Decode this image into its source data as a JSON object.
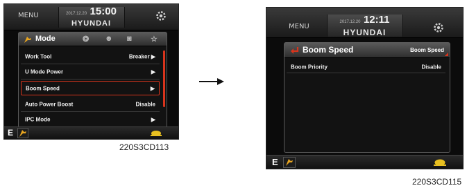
{
  "left": {
    "header": {
      "menu": "MENU",
      "date": "2017.12.20",
      "time": "15:00",
      "brand": "HYUNDAI",
      "settings_icon": "settings-gear-icon"
    },
    "panel": {
      "title": "Mode",
      "tabs": [
        "mode-tab-icon",
        "settings-tab-icon",
        "user-tab-icon",
        "camera-tab-icon",
        "favorite-tab-icon"
      ],
      "rows": [
        {
          "label": "Work Tool",
          "value": "Breaker ▶"
        },
        {
          "label": "U Mode Power",
          "value": "▶"
        },
        {
          "label": "Boom Speed",
          "value": "▶"
        },
        {
          "label": "Auto Power Boost",
          "value": "Disable"
        },
        {
          "label": "IPC Mode",
          "value": "▶"
        }
      ]
    },
    "footer": {
      "mode": "E"
    },
    "caption": "220S3CD113"
  },
  "right": {
    "header": {
      "menu": "MENU",
      "date": "2017.12.20",
      "time": "12:11",
      "brand": "HYUNDAI",
      "settings_icon": "settings-gear-icon"
    },
    "panel": {
      "title": "Boom Speed",
      "title_value": "Boom Speed",
      "rows": [
        {
          "label": "Boom Priority",
          "value": "Disable"
        }
      ]
    },
    "footer": {
      "mode": "E"
    },
    "caption": "220S3CD115"
  },
  "colors": {
    "accent": "#d8341c",
    "background": "#0b0b0b",
    "tool_icon": "#e8a520"
  }
}
